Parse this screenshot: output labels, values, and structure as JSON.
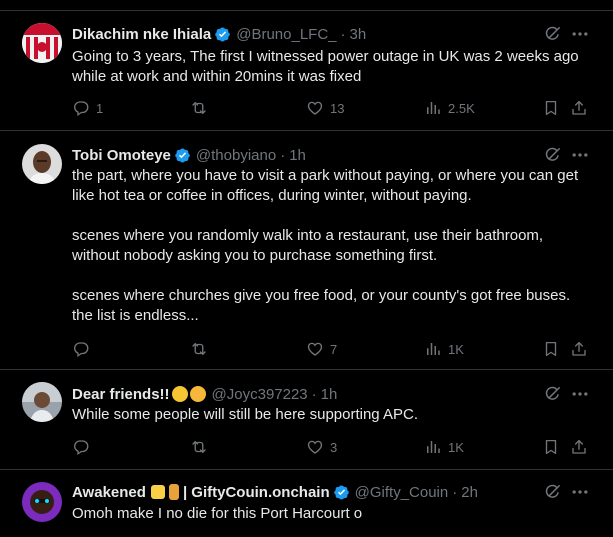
{
  "tweets": [
    {
      "name": "Dikachim nke Ihiala",
      "handle": "@Bruno_LFC_",
      "time": "3h",
      "text": [
        "Going to 3 years, The first I witnessed power outage in UK was 2 weeks ago while at work and within 20mins it was fixed"
      ],
      "replies": "1",
      "retweets": "",
      "likes": "13",
      "views": "2.5K"
    },
    {
      "name": "Tobi Omoteye",
      "handle": "@thobyiano",
      "time": "1h",
      "text": [
        "the part, where you have to visit a park without paying, or where you can get like hot tea or coffee in offices, during winter, without paying.",
        "scenes where you randomly walk into a restaurant, use their bathroom, without nobody asking you to purchase something first.",
        "scenes where churches give you free food, or your county's got free buses. the list is endless..."
      ],
      "replies": "",
      "retweets": "",
      "likes": "7",
      "views": "1K"
    },
    {
      "name": "Dear friends!!",
      "handle": "@Joyc397223",
      "time": "1h",
      "text": [
        "While some people will still be here supporting APC."
      ],
      "replies": "",
      "retweets": "",
      "likes": "3",
      "views": "1K"
    },
    {
      "name": "Awakened",
      "name_suffix": "| GiftyCouin.onchain",
      "handle": "@Gifty_Couin",
      "time": "2h",
      "text": [
        "Omoh make I no die for this Port Harcourt o"
      ]
    }
  ],
  "separator": "·",
  "colors": {
    "background": "#000000",
    "text": "#e7e9ea",
    "muted": "#71767b",
    "verified": "#1d9bf0",
    "border": "#2f3336"
  },
  "icons": [
    "grok-icon",
    "more-icon",
    "reply-icon",
    "retweet-icon",
    "like-icon",
    "views-icon",
    "bookmark-icon",
    "share-icon",
    "verified-badge-icon"
  ]
}
